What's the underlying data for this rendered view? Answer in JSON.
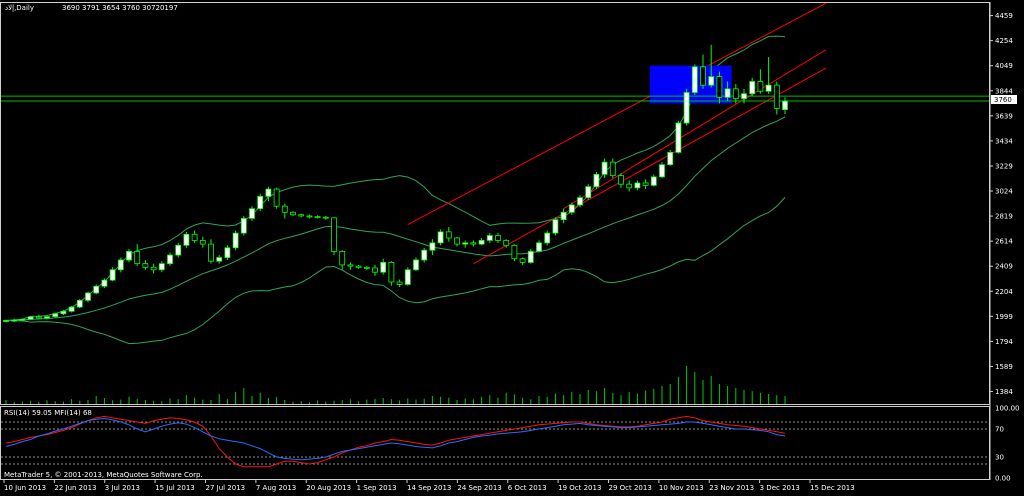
{
  "header": {
    "symbol": "إلاد,Daily",
    "ohlcv": "3690 3791 3654 3760  30720197"
  },
  "colors": {
    "background": "#000000",
    "frame": "#cfcfcf",
    "candle_up": "#ffffff",
    "candle_down": "#000000",
    "candle_outline": "#00ff00",
    "bands": "#2fa45a",
    "channel": "#ff0000",
    "volume": "#00cc00",
    "rsi": "#2a6cff",
    "mfi": "#ff1010",
    "price_line": "#00c000",
    "rectangle": "#0000ff",
    "price_tag_bg": "#ffffff",
    "price_tag_fg": "#000000"
  },
  "price_tag": "3760",
  "copyright": "MetaTrader 5, © 2001-2013, MetaQuotes Software Corp.",
  "chart_data": {
    "type": "candlestick",
    "price_axis": {
      "ticks": [
        "4459",
        "4254",
        "4049",
        "3844",
        "3639",
        "3434",
        "3229",
        "3024",
        "2819",
        "2614",
        "2409",
        "2204",
        "1999",
        "1794",
        "1589",
        "1384"
      ],
      "range": [
        1282,
        4562
      ]
    },
    "indicator_panel": {
      "title": "RSI(14) 59.05 MFI(14) 68",
      "ticks": [
        "100.00",
        "70",
        "30",
        "0.00"
      ],
      "range": [
        0,
        100
      ],
      "levels": [
        80,
        70,
        30,
        20
      ]
    },
    "x_labels": [
      "10 Jun 2013",
      "22 Jun 2013",
      "3 Jul 2013",
      "15 Jul 2013",
      "27 Jul 2013",
      "7 Aug 2013",
      "20 Aug 2013",
      "1 Sep 2013",
      "14 Sep 2013",
      "24 Sep 2013",
      "6 Oct 2013",
      "19 Oct 2013",
      "29 Oct 2013",
      "10 Nov 2013",
      "23 Nov 2013",
      "3 Dec 2013",
      "15 Dec 2013"
    ],
    "horizontal_lines": [
      3800,
      3760
    ],
    "rectangle": {
      "from_bar": 79,
      "to_bar": 88,
      "high": 4050,
      "low": 3740
    },
    "channel": [
      {
        "from_bar": 49,
        "from_value": 2750,
        "to_bar": 100,
        "to_value": 4560
      },
      {
        "from_bar": 57,
        "from_value": 2430,
        "to_bar": 100,
        "to_value": 4030
      },
      {
        "from_bar": 68,
        "from_value": 2880,
        "to_bar": 100,
        "to_value": 4180
      }
    ],
    "candles": [
      [
        1959,
        1972,
        1950,
        1965
      ],
      [
        1965,
        1979,
        1952,
        1968
      ],
      [
        1968,
        1981,
        1958,
        1974
      ],
      [
        1974,
        2000,
        1968,
        1995
      ],
      [
        1995,
        2011,
        1980,
        1985
      ],
      [
        1985,
        2004,
        1975,
        1997
      ],
      [
        1997,
        2029,
        1990,
        2020
      ],
      [
        2020,
        2050,
        2010,
        2040
      ],
      [
        2040,
        2085,
        2030,
        2075
      ],
      [
        2075,
        2140,
        2065,
        2130
      ],
      [
        2130,
        2200,
        2115,
        2190
      ],
      [
        2190,
        2260,
        2180,
        2245
      ],
      [
        2245,
        2310,
        2230,
        2295
      ],
      [
        2295,
        2400,
        2285,
        2380
      ],
      [
        2380,
        2480,
        2360,
        2460
      ],
      [
        2460,
        2550,
        2440,
        2530
      ],
      [
        2530,
        2590,
        2410,
        2430
      ],
      [
        2430,
        2460,
        2380,
        2400
      ],
      [
        2400,
        2430,
        2350,
        2380
      ],
      [
        2380,
        2450,
        2360,
        2430
      ],
      [
        2430,
        2520,
        2410,
        2500
      ],
      [
        2500,
        2600,
        2480,
        2580
      ],
      [
        2580,
        2690,
        2560,
        2670
      ],
      [
        2670,
        2700,
        2600,
        2620
      ],
      [
        2620,
        2650,
        2560,
        2590
      ],
      [
        2590,
        2630,
        2430,
        2450
      ],
      [
        2450,
        2500,
        2430,
        2480
      ],
      [
        2480,
        2580,
        2460,
        2560
      ],
      [
        2560,
        2700,
        2540,
        2680
      ],
      [
        2680,
        2820,
        2660,
        2800
      ],
      [
        2800,
        2900,
        2780,
        2880
      ],
      [
        2880,
        3000,
        2860,
        2980
      ],
      [
        2980,
        3060,
        2940,
        3040
      ],
      [
        3040,
        3050,
        2880,
        2900
      ],
      [
        2900,
        2920,
        2800,
        2850
      ],
      [
        2850,
        2860,
        2820,
        2830
      ],
      [
        2830,
        2840,
        2810,
        2820
      ],
      [
        2820,
        2830,
        2800,
        2815
      ],
      [
        2815,
        2825,
        2800,
        2810
      ],
      [
        2810,
        2820,
        2790,
        2805
      ],
      [
        2805,
        2810,
        2500,
        2530
      ],
      [
        2530,
        2540,
        2380,
        2420
      ],
      [
        2420,
        2440,
        2380,
        2410
      ],
      [
        2410,
        2420,
        2390,
        2400
      ],
      [
        2400,
        2410,
        2380,
        2395
      ],
      [
        2395,
        2420,
        2330,
        2360
      ],
      [
        2360,
        2470,
        2340,
        2440
      ],
      [
        2440,
        2450,
        2250,
        2280
      ],
      [
        2280,
        2300,
        2240,
        2260
      ],
      [
        2260,
        2400,
        2250,
        2380
      ],
      [
        2380,
        2480,
        2370,
        2460
      ],
      [
        2460,
        2560,
        2440,
        2540
      ],
      [
        2540,
        2630,
        2500,
        2600
      ],
      [
        2600,
        2710,
        2580,
        2690
      ],
      [
        2690,
        2730,
        2610,
        2640
      ],
      [
        2640,
        2650,
        2570,
        2590
      ],
      [
        2590,
        2620,
        2560,
        2600
      ],
      [
        2600,
        2620,
        2570,
        2590
      ],
      [
        2590,
        2640,
        2580,
        2620
      ],
      [
        2620,
        2680,
        2600,
        2660
      ],
      [
        2660,
        2680,
        2600,
        2620
      ],
      [
        2620,
        2630,
        2560,
        2580
      ],
      [
        2580,
        2590,
        2450,
        2470
      ],
      [
        2470,
        2480,
        2420,
        2440
      ],
      [
        2440,
        2550,
        2430,
        2530
      ],
      [
        2530,
        2620,
        2520,
        2600
      ],
      [
        2600,
        2700,
        2580,
        2680
      ],
      [
        2680,
        2810,
        2660,
        2790
      ],
      [
        2790,
        2880,
        2760,
        2850
      ],
      [
        2850,
        2930,
        2830,
        2910
      ],
      [
        2910,
        2990,
        2890,
        2970
      ],
      [
        2970,
        3080,
        2950,
        3060
      ],
      [
        3060,
        3180,
        3040,
        3160
      ],
      [
        3160,
        3290,
        3130,
        3260
      ],
      [
        3260,
        3290,
        3130,
        3150
      ],
      [
        3150,
        3170,
        3050,
        3080
      ],
      [
        3080,
        3110,
        3020,
        3050
      ],
      [
        3050,
        3110,
        3030,
        3090
      ],
      [
        3090,
        3120,
        3040,
        3070
      ],
      [
        3070,
        3160,
        3060,
        3140
      ],
      [
        3140,
        3260,
        3130,
        3240
      ],
      [
        3240,
        3360,
        3230,
        3340
      ],
      [
        3340,
        3600,
        3330,
        3580
      ],
      [
        3580,
        3860,
        3560,
        3830
      ],
      [
        3830,
        4060,
        3810,
        4040
      ],
      [
        4040,
        4140,
        3860,
        3890
      ],
      [
        3890,
        4220,
        3870,
        3960
      ],
      [
        3960,
        4000,
        3740,
        3790
      ],
      [
        3790,
        3920,
        3760,
        3860
      ],
      [
        3860,
        3900,
        3740,
        3780
      ],
      [
        3780,
        3860,
        3740,
        3820
      ],
      [
        3820,
        3950,
        3800,
        3920
      ],
      [
        3920,
        4020,
        3820,
        3840
      ],
      [
        3840,
        4120,
        3820,
        3890
      ],
      [
        3890,
        3920,
        3650,
        3700
      ],
      [
        3690,
        3791,
        3654,
        3760
      ]
    ],
    "volume": [
      0.1,
      0.05,
      0.06,
      0.08,
      0.05,
      0.09,
      0.07,
      0.06,
      0.12,
      0.08,
      0.1,
      0.2,
      0.15,
      0.09,
      0.11,
      0.18,
      0.13,
      0.1,
      0.08,
      0.07,
      0.14,
      0.12,
      0.22,
      0.16,
      0.11,
      0.1,
      0.25,
      0.12,
      0.3,
      0.4,
      0.2,
      0.28,
      0.15,
      0.18,
      0.1,
      0.06,
      0.07,
      0.05,
      0.09,
      0.06,
      0.08,
      0.1,
      0.12,
      0.07,
      0.11,
      0.13,
      0.15,
      0.12,
      0.09,
      0.14,
      0.11,
      0.13,
      0.2,
      0.18,
      0.16,
      0.1,
      0.14,
      0.12,
      0.18,
      0.22,
      0.16,
      0.28,
      0.24,
      0.15,
      0.12,
      0.2,
      0.18,
      0.26,
      0.22,
      0.3,
      0.25,
      0.35,
      0.32,
      0.4,
      0.28,
      0.22,
      0.3,
      0.26,
      0.34,
      0.38,
      0.45,
      0.5,
      0.68,
      0.95,
      0.8,
      0.6,
      0.7,
      0.5,
      0.45,
      0.4,
      0.35,
      0.32,
      0.28,
      0.25,
      0.22,
      0.2
    ],
    "rsi": [
      45,
      48,
      52,
      55,
      60,
      63,
      67,
      70,
      74,
      78,
      82,
      84,
      85,
      83,
      80,
      76,
      70,
      66,
      70,
      74,
      77,
      79,
      77,
      72,
      66,
      60,
      56,
      54,
      52,
      50,
      46,
      42,
      36,
      30,
      28,
      27,
      26,
      27,
      28,
      30,
      34,
      38,
      40,
      42,
      44,
      46,
      48,
      50,
      49,
      47,
      45,
      44,
      43,
      46,
      50,
      52,
      55,
      58,
      60,
      61,
      63,
      64,
      65,
      66,
      68,
      70,
      72,
      74,
      76,
      77,
      78,
      76,
      75,
      74,
      73,
      72,
      72,
      73,
      74,
      75,
      76,
      77,
      78,
      80,
      80,
      78,
      76,
      74,
      72,
      70,
      70,
      69,
      68,
      66,
      62,
      60
    ],
    "mfi": [
      50,
      52,
      55,
      58,
      60,
      62,
      65,
      68,
      72,
      77,
      82,
      86,
      88,
      86,
      84,
      82,
      80,
      78,
      82,
      84,
      86,
      85,
      83,
      80,
      74,
      60,
      42,
      30,
      20,
      16,
      16,
      16,
      16,
      20,
      24,
      24,
      22,
      20,
      22,
      26,
      30,
      36,
      40,
      44,
      46,
      50,
      52,
      55,
      54,
      52,
      50,
      48,
      47,
      50,
      54,
      56,
      58,
      60,
      62,
      64,
      66,
      68,
      70,
      72,
      74,
      76,
      77,
      78,
      79,
      80,
      80,
      78,
      76,
      75,
      74,
      73,
      73,
      74,
      76,
      78,
      80,
      84,
      86,
      88,
      86,
      82,
      80,
      78,
      76,
      75,
      74,
      72,
      70,
      68,
      66,
      64
    ]
  }
}
